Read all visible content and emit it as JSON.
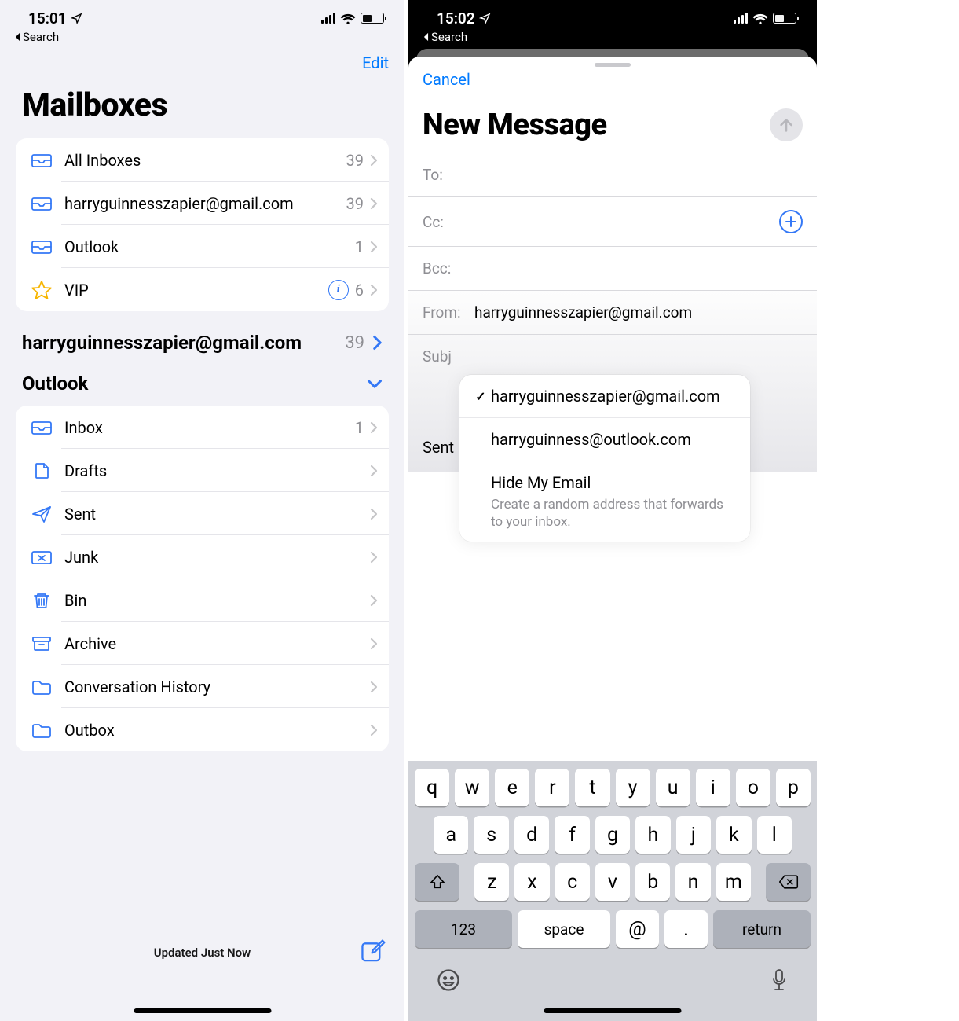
{
  "left": {
    "status": {
      "time": "15:01",
      "back_label": "Search"
    },
    "nav": {
      "edit": "Edit"
    },
    "title": "Mailboxes",
    "top_group": [
      {
        "icon": "inbox-icon",
        "label": "All Inboxes",
        "count": "39",
        "info": false
      },
      {
        "icon": "inbox-icon",
        "label": "harryguinnesszapier@gmail.com",
        "count": "39",
        "info": false
      },
      {
        "icon": "inbox-icon",
        "label": "Outlook",
        "count": "1",
        "info": false
      },
      {
        "icon": "star-icon",
        "label": "VIP",
        "count": "6",
        "info": true
      }
    ],
    "account_header": {
      "label": "harryguinnesszapier@gmail.com",
      "count": "39"
    },
    "outlook_header": {
      "label": "Outlook"
    },
    "outlook_group": [
      {
        "icon": "inbox-icon",
        "label": "Inbox",
        "count": "1"
      },
      {
        "icon": "doc-icon",
        "label": "Drafts",
        "count": ""
      },
      {
        "icon": "sent-icon",
        "label": "Sent",
        "count": ""
      },
      {
        "icon": "junk-icon",
        "label": "Junk",
        "count": ""
      },
      {
        "icon": "trash-icon",
        "label": "Bin",
        "count": ""
      },
      {
        "icon": "archive-icon",
        "label": "Archive",
        "count": ""
      },
      {
        "icon": "folder-icon",
        "label": "Conversation History",
        "count": ""
      },
      {
        "icon": "folder-icon",
        "label": "Outbox",
        "count": ""
      }
    ],
    "bottom": {
      "status": "Updated Just Now"
    }
  },
  "right": {
    "status": {
      "time": "15:02",
      "back_label": "Search"
    },
    "sheet": {
      "cancel": "Cancel",
      "title": "New Message",
      "fields": {
        "to_label": "To:",
        "cc_label": "Cc:",
        "bcc_label": "Bcc:",
        "from_label": "From:",
        "from_value": "harryguinnesszapier@gmail.com",
        "subject_partial": "Subj",
        "body_partial": "Sent"
      },
      "popover": {
        "items": [
          {
            "checked": true,
            "text": "harryguinnesszapier@gmail.com",
            "sub": ""
          },
          {
            "checked": false,
            "text": "harryguinness@outlook.com",
            "sub": ""
          },
          {
            "checked": false,
            "text": "Hide My Email",
            "sub": "Create a random address that forwards to your inbox."
          }
        ]
      }
    },
    "keyboard": {
      "rows": [
        [
          "q",
          "w",
          "e",
          "r",
          "t",
          "y",
          "u",
          "i",
          "o",
          "p"
        ],
        [
          "a",
          "s",
          "d",
          "f",
          "g",
          "h",
          "j",
          "k",
          "l"
        ],
        [
          "z",
          "x",
          "c",
          "v",
          "b",
          "n",
          "m"
        ]
      ],
      "k123": "123",
      "space": "space",
      "at": "@",
      "dot": ".",
      "ret": "return"
    }
  }
}
